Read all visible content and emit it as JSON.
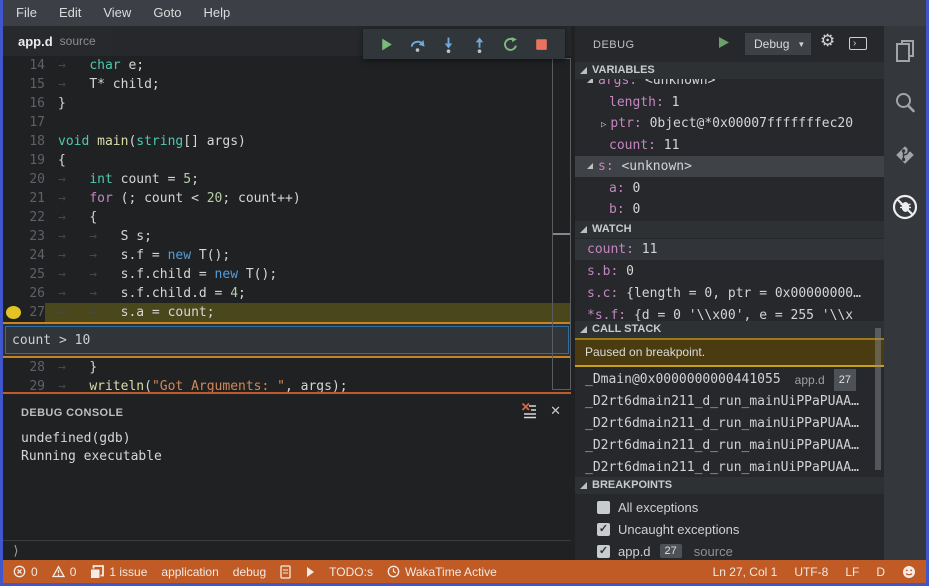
{
  "colors": {
    "window_border": "#3f57cb",
    "status_bar": "#c05b26",
    "breakpoint": "#e2c227",
    "condition_border": "#c8821f",
    "paused_bg": "#4a3b10",
    "debug_accent_blue": "#6fa8dc",
    "debug_accent_green": "#7cb97c",
    "stop_red": "#e9735f"
  },
  "menu": {
    "items": [
      "File",
      "Edit",
      "View",
      "Goto",
      "Help"
    ]
  },
  "editor": {
    "tab": {
      "name": "app.d",
      "hint": "source"
    },
    "toolbar_icons": [
      "continue",
      "step-over",
      "step-into",
      "step-out",
      "restart",
      "stop"
    ],
    "breakpoint_line": "27",
    "condition_widget": {
      "text": "count > 10"
    },
    "lines": [
      {
        "num": "14",
        "tokens": [
          {
            "c": "ws",
            "s": "→   "
          },
          {
            "c": "t",
            "s": "char"
          },
          {
            "c": "p",
            "s": " e;"
          }
        ]
      },
      {
        "num": "15",
        "tokens": [
          {
            "c": "ws",
            "s": "→   "
          },
          {
            "c": "p",
            "s": "T* child;"
          }
        ]
      },
      {
        "num": "16",
        "tokens": [
          {
            "c": "p",
            "s": "}"
          }
        ]
      },
      {
        "num": "17",
        "tokens": []
      },
      {
        "num": "18",
        "tokens": [
          {
            "c": "t",
            "s": "void"
          },
          {
            "c": "p",
            "s": " "
          },
          {
            "c": "fn",
            "s": "main"
          },
          {
            "c": "p",
            "s": "("
          },
          {
            "c": "t",
            "s": "string"
          },
          {
            "c": "p",
            "s": "[] args)"
          }
        ]
      },
      {
        "num": "19",
        "tokens": [
          {
            "c": "p",
            "s": "{"
          }
        ]
      },
      {
        "num": "20",
        "tokens": [
          {
            "c": "ws",
            "s": "→   "
          },
          {
            "c": "t",
            "s": "int"
          },
          {
            "c": "p",
            "s": " count = "
          },
          {
            "c": "num",
            "s": "5"
          },
          {
            "c": "p",
            "s": ";"
          }
        ]
      },
      {
        "num": "21",
        "tokens": [
          {
            "c": "ws",
            "s": "→   "
          },
          {
            "c": "k",
            "s": "for"
          },
          {
            "c": "p",
            "s": " (; count < "
          },
          {
            "c": "num",
            "s": "20"
          },
          {
            "c": "p",
            "s": "; count++)"
          }
        ]
      },
      {
        "num": "22",
        "tokens": [
          {
            "c": "ws",
            "s": "→   "
          },
          {
            "c": "p",
            "s": "{"
          }
        ]
      },
      {
        "num": "23",
        "tokens": [
          {
            "c": "ws",
            "s": "→   →   "
          },
          {
            "c": "p",
            "s": "S s;"
          }
        ]
      },
      {
        "num": "24",
        "tokens": [
          {
            "c": "ws",
            "s": "→   →   "
          },
          {
            "c": "p",
            "s": "s.f = "
          },
          {
            "c": "n",
            "s": "new"
          },
          {
            "c": "p",
            "s": " T();"
          }
        ]
      },
      {
        "num": "25",
        "tokens": [
          {
            "c": "ws",
            "s": "→   →   "
          },
          {
            "c": "p",
            "s": "s.f.child = "
          },
          {
            "c": "n",
            "s": "new"
          },
          {
            "c": "p",
            "s": " T();"
          }
        ]
      },
      {
        "num": "26",
        "tokens": [
          {
            "c": "ws",
            "s": "→   →   "
          },
          {
            "c": "p",
            "s": "s.f.child.d = "
          },
          {
            "c": "num",
            "s": "4"
          },
          {
            "c": "p",
            "s": ";"
          }
        ]
      },
      {
        "num": "27",
        "current": true,
        "tokens": [
          {
            "c": "ws",
            "s": "→   →   "
          },
          {
            "c": "p",
            "s": "s.a = count;"
          }
        ]
      },
      {
        "num": "28",
        "tokens": [
          {
            "c": "ws",
            "s": "→   "
          },
          {
            "c": "p",
            "s": "}"
          }
        ]
      },
      {
        "num": "29",
        "tokens": [
          {
            "c": "ws",
            "s": "→   "
          },
          {
            "c": "fn u",
            "s": "writeln"
          },
          {
            "c": "p u",
            "s": "("
          },
          {
            "c": "s u",
            "s": "\"Got Arguments: \""
          },
          {
            "c": "p u",
            "s": ", args);"
          }
        ]
      }
    ]
  },
  "console": {
    "title": "DEBUG CONSOLE",
    "lines": [
      "undefined(gdb)",
      "Running executable"
    ],
    "prompt": "⟩"
  },
  "debug_panel": {
    "title": "DEBUG",
    "config_dropdown": "Debug",
    "sections": {
      "variables": {
        "title": "VARIABLES",
        "rows": [
          {
            "twistie": "open",
            "name": "args",
            "value": "<unknown>",
            "indent": 0
          },
          {
            "twistie": null,
            "name": "length",
            "value": "1",
            "indent": 1
          },
          {
            "twistie": "closed",
            "name": "ptr",
            "value": "0bject@*0x00007fffffffec20",
            "indent": 1
          },
          {
            "twistie": null,
            "name": "count",
            "value": "11",
            "indent": 1
          },
          {
            "twistie": "open",
            "name": "s",
            "value": "<unknown>",
            "indent": 0,
            "selected": true
          },
          {
            "twistie": null,
            "name": "a",
            "value": "0",
            "indent": 1
          },
          {
            "twistie": null,
            "name": "b",
            "value": "0",
            "indent": 1
          }
        ]
      },
      "watch": {
        "title": "WATCH",
        "rows": [
          {
            "name": "count",
            "value": "11",
            "highlighted": true
          },
          {
            "name": "s.b",
            "value": "0"
          },
          {
            "name": "s.c",
            "value": "{length = 0, ptr = 0x00000000…"
          },
          {
            "name": "*s.f",
            "value": "{d = 0 '\\\\x00', e = 255 '\\\\x"
          }
        ]
      },
      "call_stack": {
        "title": "CALL STACK",
        "status": "Paused on breakpoint.",
        "frames": [
          {
            "fn": "_Dmain@0x0000000000441055",
            "file": "app.d",
            "line": "27"
          },
          {
            "fn": "_D2rt6dmain211_d_run_mainUiPPaPUAA…"
          },
          {
            "fn": "_D2rt6dmain211_d_run_mainUiPPaPUAA…"
          },
          {
            "fn": "_D2rt6dmain211_d_run_mainUiPPaPUAA…"
          },
          {
            "fn": "_D2rt6dmain211_d_run_mainUiPPaPUAA…"
          }
        ]
      },
      "breakpoints": {
        "title": "BREAKPOINTS",
        "rows": [
          {
            "checked": false,
            "label": "All exceptions"
          },
          {
            "checked": true,
            "label": "Uncaught exceptions"
          },
          {
            "checked": true,
            "label": "app.d",
            "badge": "27",
            "hint": "source"
          }
        ]
      }
    }
  },
  "activity_bar": {
    "icons": [
      {
        "name": "explorer"
      },
      {
        "name": "search"
      },
      {
        "name": "source-control"
      },
      {
        "name": "debug",
        "active": true
      }
    ]
  },
  "status_bar": {
    "left": [
      {
        "icon": "error",
        "text": "0"
      },
      {
        "icon": "warning",
        "text": "0"
      },
      {
        "icon": "issues",
        "text": "1 issue"
      },
      {
        "text": "application"
      },
      {
        "text": "debug"
      },
      {
        "icon": "file"
      },
      {
        "icon": "play"
      },
      {
        "text": "TODO:s"
      },
      {
        "icon": "clock",
        "text": "WakaTime Active"
      }
    ],
    "right": [
      {
        "text": "Ln 27, Col 1"
      },
      {
        "text": "UTF-8"
      },
      {
        "text": "LF"
      },
      {
        "text": "D"
      },
      {
        "icon": "smiley"
      }
    ]
  }
}
